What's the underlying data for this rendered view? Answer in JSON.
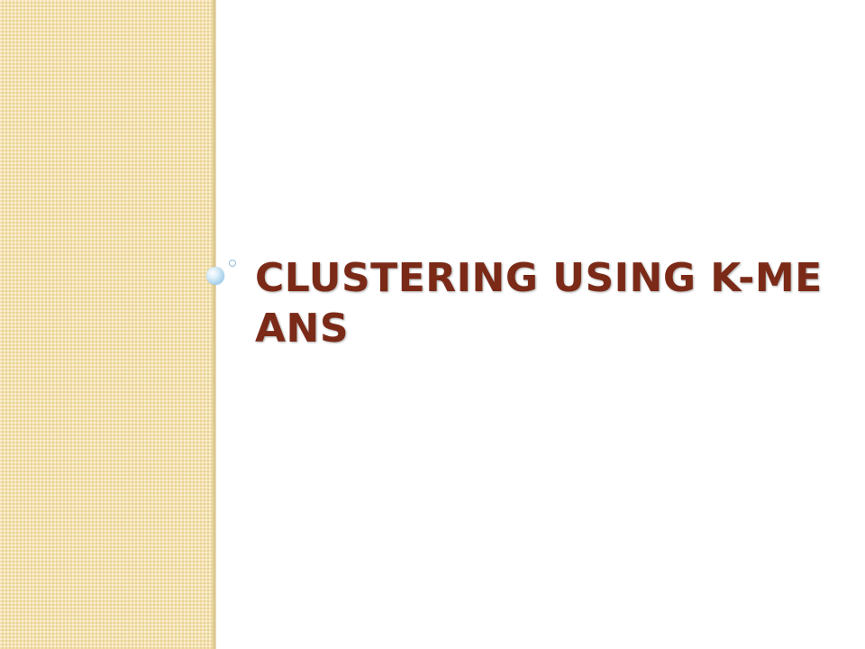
{
  "slide": {
    "title": "CLUSTERING USING K-MEANS",
    "title_color": "#7b2a17",
    "panel_color": "#f3e0ab",
    "decorations": [
      "bubble-icon-large",
      "bubble-icon-small"
    ]
  }
}
